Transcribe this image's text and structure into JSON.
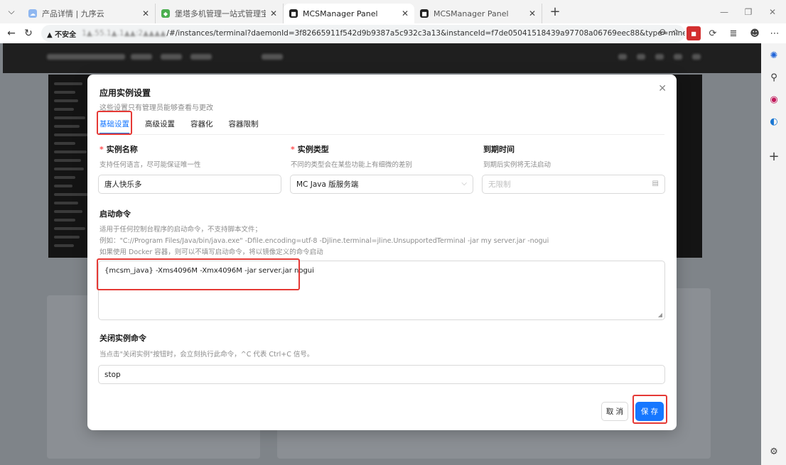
{
  "browser": {
    "tabs": [
      {
        "title": "产品详情 | 九序云",
        "active": false
      },
      {
        "title": "堡塔多机管理一站式管理宝塔面板",
        "active": false
      },
      {
        "title": "MCSManager Panel",
        "active": true
      },
      {
        "title": "MCSManager Panel",
        "active": false
      }
    ],
    "address": {
      "security_label": "▲ 不安全",
      "host": "1▲.55.1▲.1▲▲:2▲▲▲▲",
      "path": "/#/instances/terminal?daemonId=3f82665911f542d9b9387a5c932c3a13&instanceId=f7de05041518439a97708a06769eec88&type=minecraft/jav..."
    }
  },
  "modal": {
    "title": "应用实例设置",
    "subtitle": "这些设置只有管理员能够查看与更改",
    "tabs": [
      "基础设置",
      "高级设置",
      "容器化",
      "容器限制"
    ],
    "active_tab": "基础设置",
    "fields": {
      "instance_name": {
        "label": "实例名称",
        "desc": "支持任何语言，尽可能保证唯一性",
        "value": "唐人快乐多"
      },
      "instance_type": {
        "label": "实例类型",
        "desc": "不同的类型会在某些功能上有细微的差别",
        "value": "MC Java 版服务端"
      },
      "expire_time": {
        "label": "到期时间",
        "desc": "到期后实例将无法启动",
        "placeholder": "无限制"
      },
      "start_command": {
        "label": "启动命令",
        "desc_line1": "适用于任何控制台程序的启动命令，不支持脚本文件；",
        "desc_line2": "例如：\"C://Program Files/Java/bin/java.exe\" -Dfile.encoding=utf-8 -Djline.terminal=jline.UnsupportedTerminal -jar my server.jar -nogui",
        "desc_line3": "如果使用 Docker 容器，则可以不填写启动命令，将以镜像定义的命令启动",
        "value": "{mcsm_java} -Xms4096M -Xmx4096M -jar server.jar nogui"
      },
      "stop_command": {
        "label": "关闭实例命令",
        "desc": "当点击\"关闭实例\"按钮时，会立刻执行此命令，^C 代表 Ctrl+C 信号。",
        "value": "stop"
      }
    },
    "buttons": {
      "cancel": "取 消",
      "save": "保 存"
    }
  },
  "colors": {
    "accent": "#1677ff",
    "highlight": "#e53935",
    "required": "#ff4d4f"
  }
}
